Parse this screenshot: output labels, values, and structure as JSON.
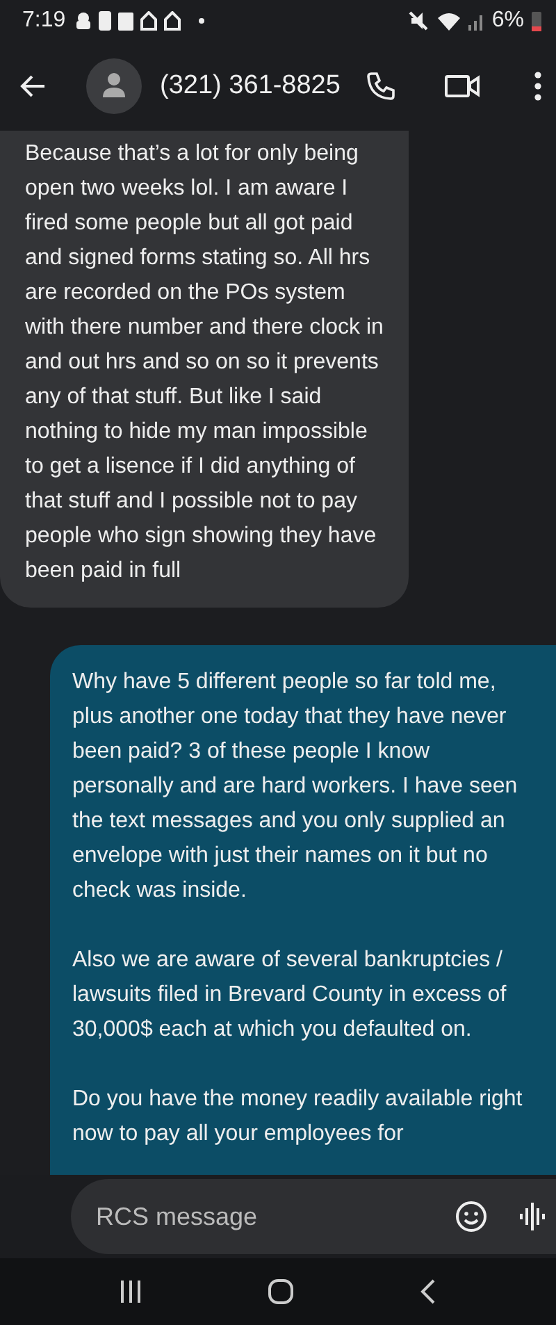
{
  "status_bar": {
    "time": "7:19",
    "battery": "6%"
  },
  "header": {
    "contact": "(321) 361-8825"
  },
  "messages": [
    {
      "kind": "received",
      "paragraphs": [
        "Because that’s a lot for only being open two weeks lol. I am aware I fired some people but all got paid and signed forms stating so. All hrs are recorded on the POs system with there number and there clock in and out hrs and so on so it prevents any of that stuff. But like I said nothing to hide my man impossible to get a lisence if I did anything of that stuff and I possible not to pay people who sign showing they have been paid in full"
      ]
    },
    {
      "kind": "sent",
      "paragraphs": [
        "Why have 5 different people so far told me, plus another one today that they have never been paid? 3  of these people I know personally and are hard workers. I have seen the text messages and you only supplied an envelope with just their names on it but no check was inside.",
        "Also we are aware of several bankruptcies / lawsuits filed in Brevard County in excess of 30,000$ each at which you defaulted on.",
        "Do you have the money readily available right now to pay all your employees for"
      ]
    }
  ],
  "composer": {
    "placeholder": "RCS message"
  }
}
